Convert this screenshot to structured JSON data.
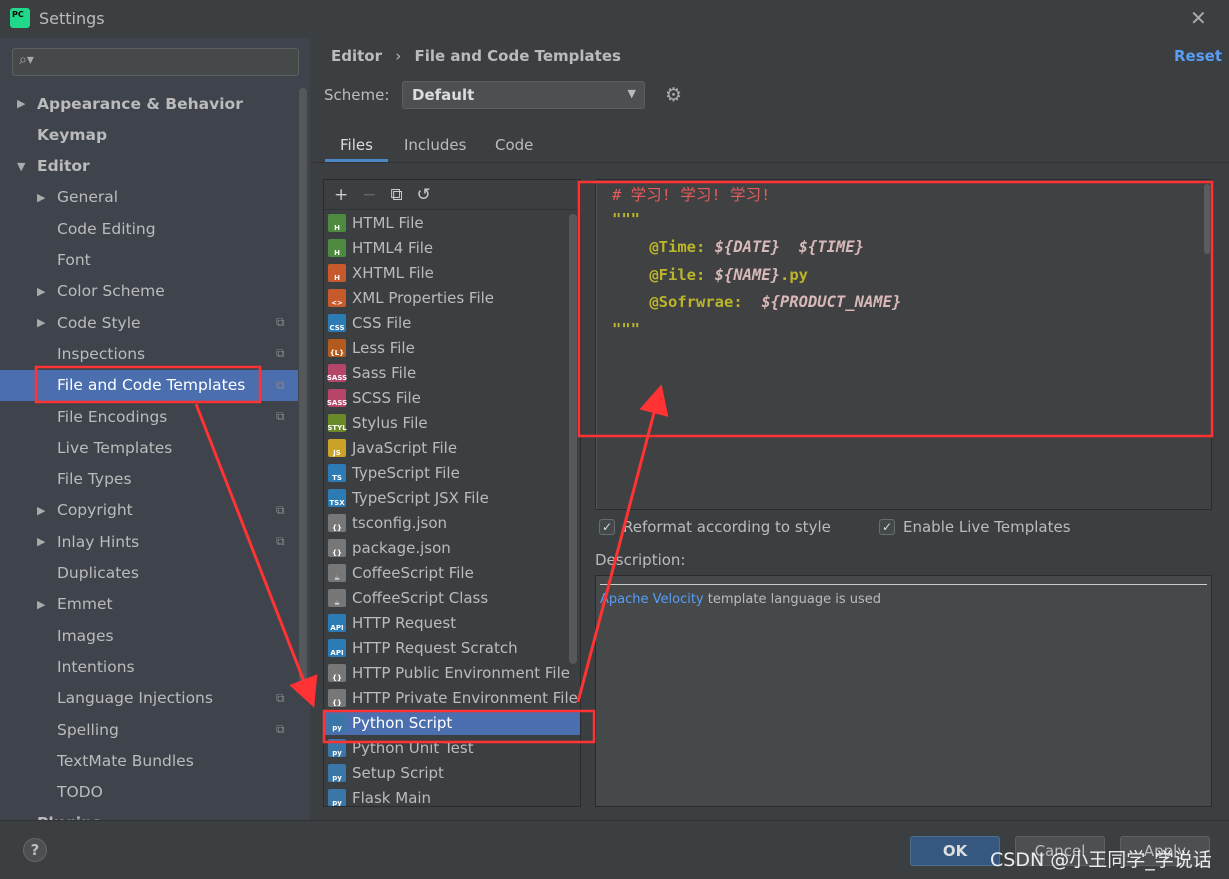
{
  "window": {
    "title": "Settings",
    "logo_text": "PC"
  },
  "search": {
    "placeholder": ""
  },
  "sidebar": {
    "items": [
      {
        "label": "Appearance & Behavior",
        "arrow": "▶",
        "bold": true,
        "indent": 0
      },
      {
        "label": "Keymap",
        "bold": true,
        "indent": 0
      },
      {
        "label": "Editor",
        "arrow": "▼",
        "bold": true,
        "indent": 0
      },
      {
        "label": "General",
        "arrow": "▶",
        "indent": 1
      },
      {
        "label": "Code Editing",
        "indent": 1
      },
      {
        "label": "Font",
        "indent": 1
      },
      {
        "label": "Color Scheme",
        "arrow": "▶",
        "indent": 1
      },
      {
        "label": "Code Style",
        "arrow": "▶",
        "indent": 1,
        "copy": true
      },
      {
        "label": "Inspections",
        "indent": 1,
        "copy": true
      },
      {
        "label": "File and Code Templates",
        "indent": 1,
        "copy": true,
        "selected": true
      },
      {
        "label": "File Encodings",
        "indent": 1,
        "copy": true
      },
      {
        "label": "Live Templates",
        "indent": 1
      },
      {
        "label": "File Types",
        "indent": 1
      },
      {
        "label": "Copyright",
        "arrow": "▶",
        "indent": 1,
        "copy": true
      },
      {
        "label": "Inlay Hints",
        "arrow": "▶",
        "indent": 1,
        "copy": true
      },
      {
        "label": "Duplicates",
        "indent": 1
      },
      {
        "label": "Emmet",
        "arrow": "▶",
        "indent": 1
      },
      {
        "label": "Images",
        "indent": 1
      },
      {
        "label": "Intentions",
        "indent": 1
      },
      {
        "label": "Language Injections",
        "indent": 1,
        "copy": true
      },
      {
        "label": "Spelling",
        "indent": 1,
        "copy": true
      },
      {
        "label": "TextMate Bundles",
        "indent": 1
      },
      {
        "label": "TODO",
        "indent": 1
      },
      {
        "label": "Plugins",
        "bold": true,
        "indent": 0
      }
    ]
  },
  "header": {
    "breadcrumb": [
      "Editor",
      "File and Code Templates"
    ],
    "separator": "›",
    "reset": "Reset"
  },
  "scheme": {
    "label": "Scheme:",
    "value": "Default"
  },
  "tabs": [
    "Files",
    "Includes",
    "Code"
  ],
  "active_tab": "Files",
  "files": [
    {
      "name": "HTML File",
      "icon": "H",
      "color": "#4e8a3e"
    },
    {
      "name": "HTML4 File",
      "icon": "H",
      "color": "#4e8a3e"
    },
    {
      "name": "XHTML File",
      "icon": "H",
      "color": "#c75a2c"
    },
    {
      "name": "XML Properties File",
      "icon": "<>",
      "color": "#c75a2c"
    },
    {
      "name": "CSS File",
      "icon": "CSS",
      "color": "#2d7bb5"
    },
    {
      "name": "Less File",
      "icon": "{L}",
      "color": "#b35b1e"
    },
    {
      "name": "Sass File",
      "icon": "SASS",
      "color": "#b5466a"
    },
    {
      "name": "SCSS File",
      "icon": "SASS",
      "color": "#b5466a"
    },
    {
      "name": "Stylus File",
      "icon": "STYL",
      "color": "#6a8a2a"
    },
    {
      "name": "JavaScript File",
      "icon": "JS",
      "color": "#c9a227"
    },
    {
      "name": "TypeScript File",
      "icon": "TS",
      "color": "#2d7bb5"
    },
    {
      "name": "TypeScript JSX File",
      "icon": "TSX",
      "color": "#2d7bb5"
    },
    {
      "name": "tsconfig.json",
      "icon": "{}",
      "color": "#777"
    },
    {
      "name": "package.json",
      "icon": "{}",
      "color": "#777"
    },
    {
      "name": "CoffeeScript File",
      "icon": "☕",
      "color": "#777"
    },
    {
      "name": "CoffeeScript Class",
      "icon": "☕",
      "color": "#777"
    },
    {
      "name": "HTTP Request",
      "icon": "API",
      "color": "#2d7bb5"
    },
    {
      "name": "HTTP Request Scratch",
      "icon": "API",
      "color": "#2d7bb5"
    },
    {
      "name": "HTTP Public Environment File",
      "icon": "{}",
      "color": "#777"
    },
    {
      "name": "HTTP Private Environment File",
      "icon": "{}",
      "color": "#777"
    },
    {
      "name": "Python Script",
      "icon": "py",
      "color": "#3b76a8",
      "selected": true
    },
    {
      "name": "Python Unit Test",
      "icon": "py",
      "color": "#3b76a8"
    },
    {
      "name": "Setup Script",
      "icon": "py",
      "color": "#3b76a8"
    },
    {
      "name": "Flask Main",
      "icon": "py",
      "color": "#3b76a8"
    }
  ],
  "editor": {
    "comment": "# 学习! 学习! 学习!",
    "quote_open": "\"\"\"",
    "time_key": "    @Time: ",
    "time_val1": "${DATE}",
    "time_sp": "  ",
    "time_val2": "${TIME}",
    "file_key": "    @File: ",
    "file_val": "${NAME}",
    "file_ext": ".py",
    "soft_key": "    @Sofrwrae:  ",
    "soft_val": "${PRODUCT_NAME}",
    "quote_close": "\"\"\""
  },
  "options": {
    "reformat": "Reformat according to style",
    "reformat_checked": true,
    "live": "Enable Live Templates",
    "live_checked": true
  },
  "description": {
    "label": "Description:",
    "link": "Apache Velocity",
    "text": " template language is used"
  },
  "footer": {
    "help": "?",
    "ok": "OK",
    "cancel": "Cancel",
    "apply": "Apply"
  },
  "watermark": "CSDN @小王同学_学说话",
  "colors": {
    "selection": "#4b6eaf",
    "annotation": "#ff3333",
    "link": "#589df6"
  }
}
